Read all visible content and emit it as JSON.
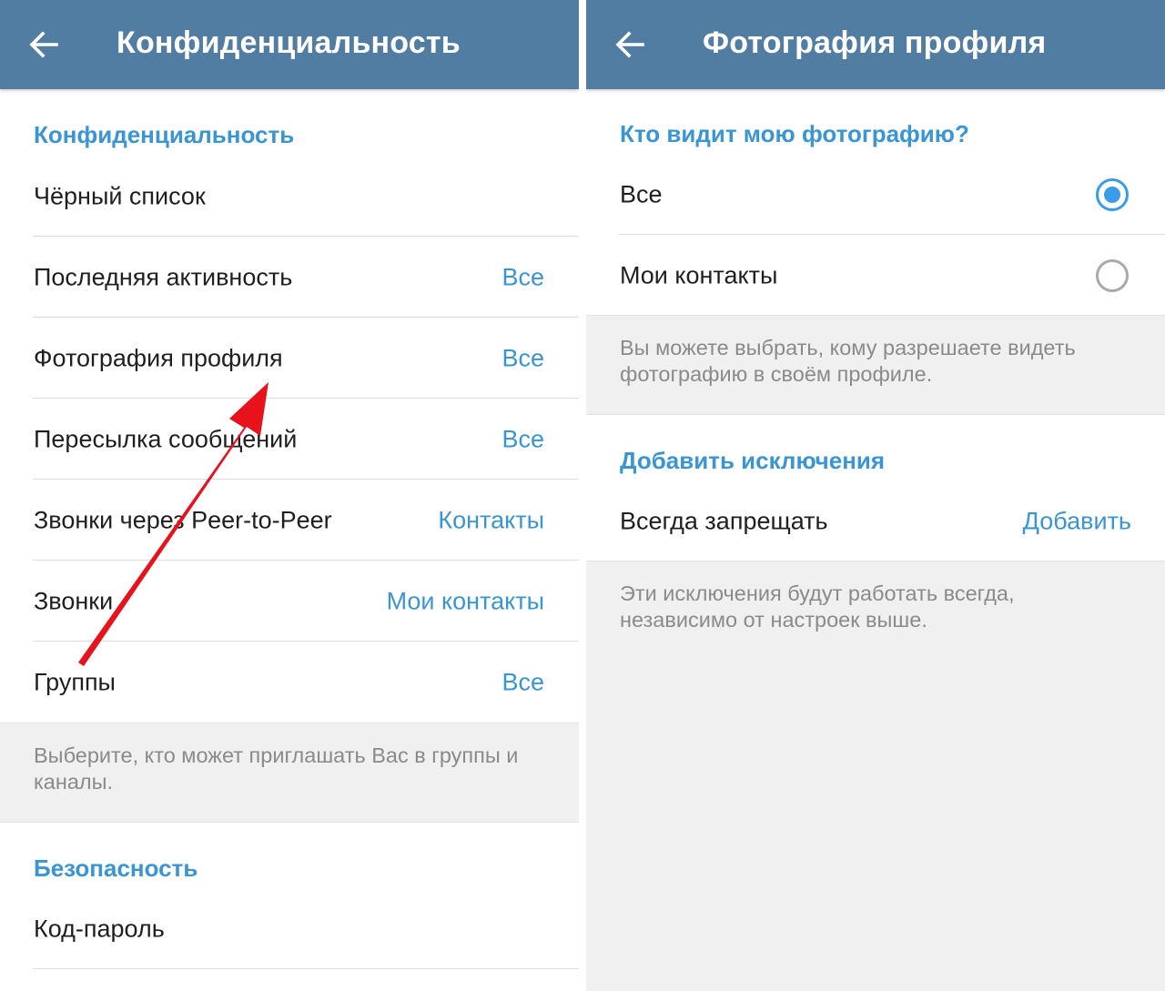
{
  "colors": {
    "appbar": "#527da3",
    "accent": "#3a95d5",
    "radio_active": "#3a9ce8",
    "info_background": "#f0f0f0",
    "annotation_arrow": "#e8121c"
  },
  "privacy_screen": {
    "title": "Конфиденциальность",
    "back_icon": "arrow-left-icon",
    "privacy_section": {
      "header": "Конфиденциальность",
      "items": [
        {
          "label": "Чёрный список",
          "value": ""
        },
        {
          "label": "Последняя активность",
          "value": "Все"
        },
        {
          "label": "Фотография профиля",
          "value": "Все"
        },
        {
          "label": "Пересылка сообщений",
          "value": "Все"
        },
        {
          "label": "Звонки через Peer-to-Peer",
          "value": "Контакты"
        },
        {
          "label": "Звонки",
          "value": "Мои контакты"
        },
        {
          "label": "Группы",
          "value": "Все"
        }
      ],
      "footer": "Выберите, кто может приглашать Вас в группы и каналы."
    },
    "security_section": {
      "header": "Безопасность",
      "items": [
        {
          "label": "Код-пароль"
        }
      ]
    },
    "annotation": "red-arrow-pointing-to-profile-photo"
  },
  "profile_photo_screen": {
    "title": "Фотография профиля",
    "back_icon": "arrow-left-icon",
    "who_sees": {
      "header": "Кто видит мою фотографию?",
      "options": [
        {
          "label": "Все",
          "selected": true
        },
        {
          "label": "Мои контакты",
          "selected": false
        }
      ],
      "hint": "Вы можете выбрать, кому разрешаете видеть фотографию в своём профиле."
    },
    "exceptions": {
      "header": "Добавить исключения",
      "row_label": "Всегда запрещать",
      "row_action": "Добавить",
      "hint": "Эти исключения будут работать всегда, независимо от настроек выше."
    }
  }
}
